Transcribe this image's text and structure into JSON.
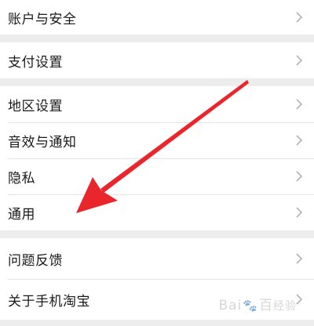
{
  "settings": {
    "groups": [
      {
        "items": [
          {
            "label": "账户与安全"
          }
        ]
      },
      {
        "items": [
          {
            "label": "支付设置"
          }
        ]
      },
      {
        "items": [
          {
            "label": "地区设置"
          },
          {
            "label": "音效与通知"
          },
          {
            "label": "隐私"
          },
          {
            "label": "通用"
          }
        ]
      },
      {
        "items": [
          {
            "label": "问题反馈"
          },
          {
            "label": "关于手机淘宝"
          }
        ]
      }
    ]
  },
  "annotation": {
    "arrow_color": "#e8262b"
  },
  "watermark": {
    "brand": "Bai",
    "brand_tail": "百",
    "suffix": "经验"
  },
  "colors": {
    "background": "#ededed",
    "row": "#ffffff",
    "divider": "#e4e4e4",
    "text": "#1a1a1a",
    "chevron": "#b2b2b2"
  }
}
